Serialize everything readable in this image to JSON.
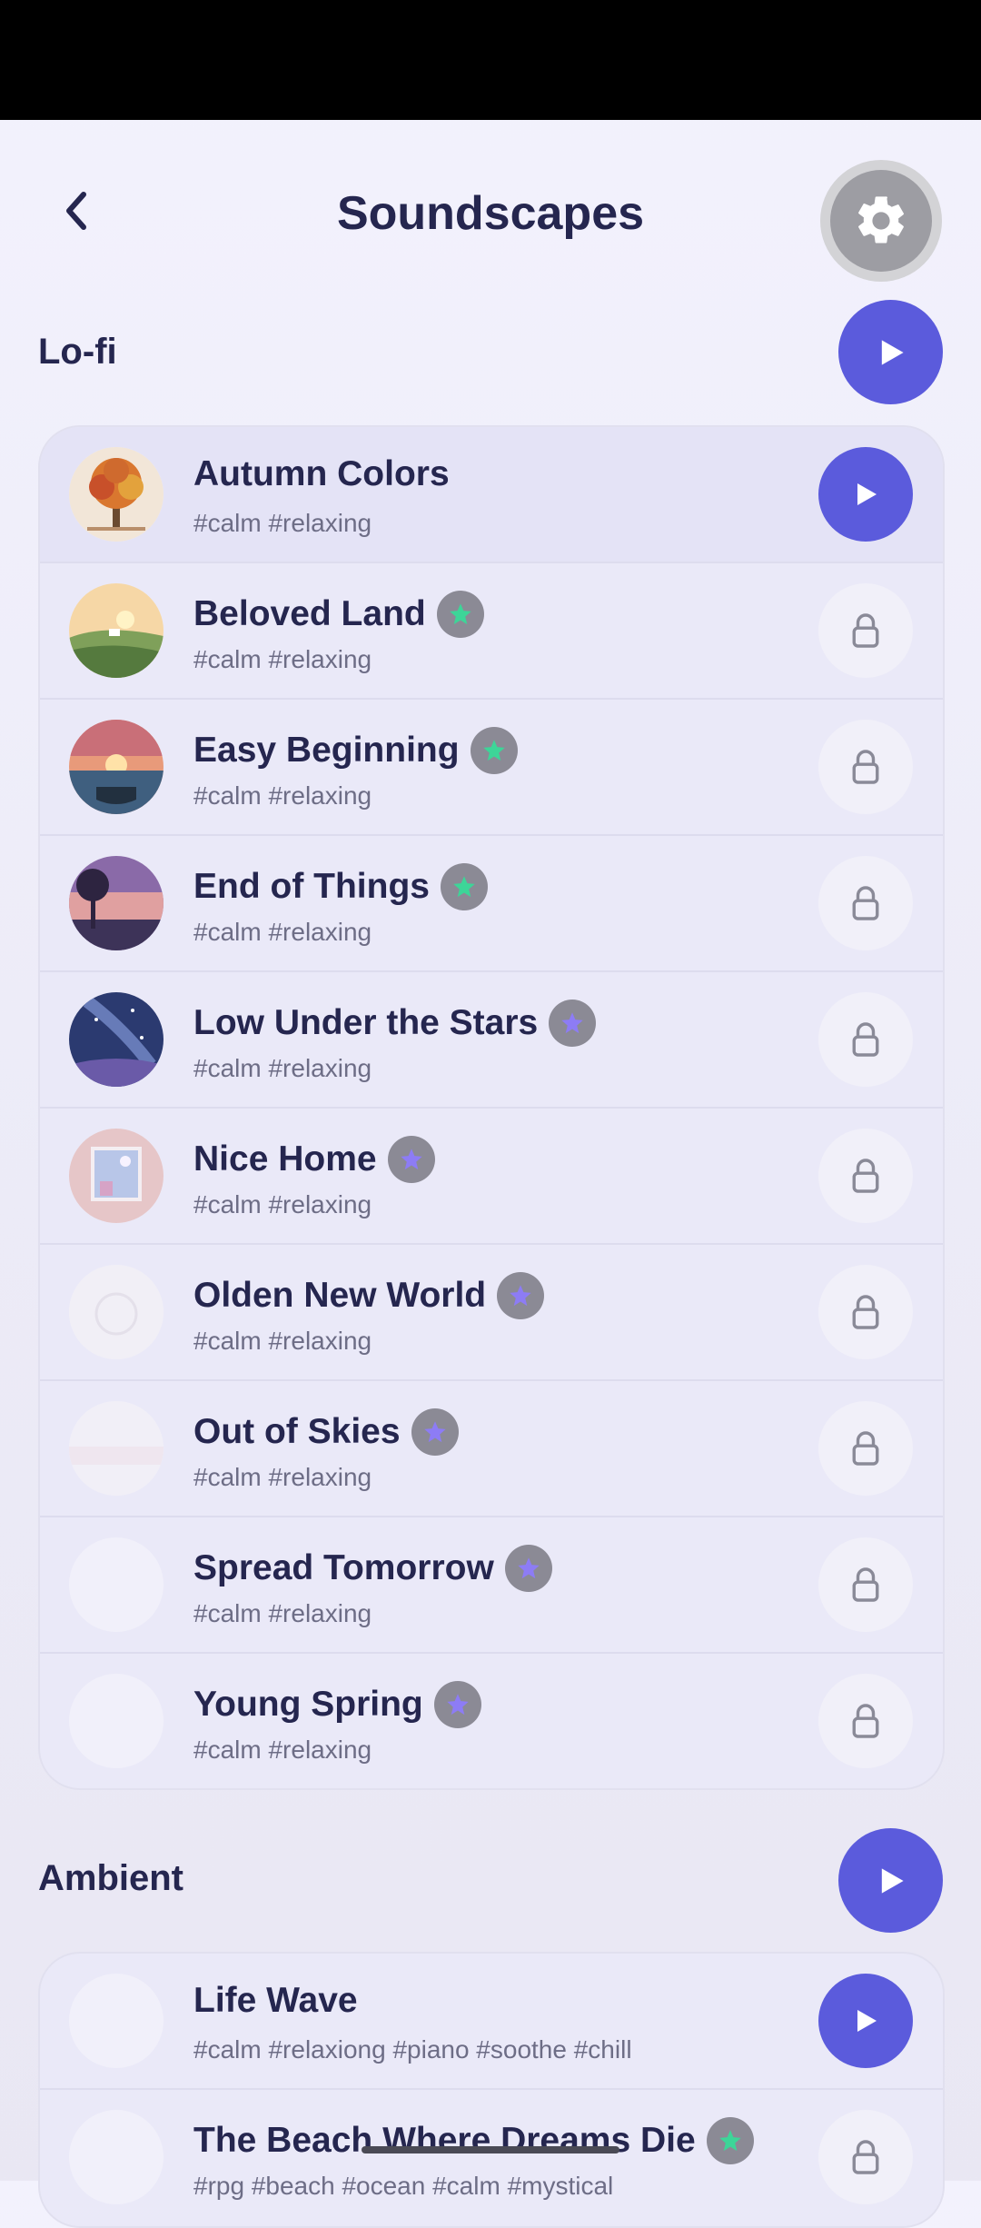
{
  "header": {
    "title": "Soundscapes",
    "back_icon": "chevron-left-icon",
    "settings_icon": "gear-icon"
  },
  "colors": {
    "accent": "#5b5bdc",
    "title_text": "#25264f",
    "tag_text": "#6d6d86",
    "badge_green": "#3dd598",
    "badge_purple": "#8d7cf5"
  },
  "sections": [
    {
      "title": "Lo-fi",
      "tracks": [
        {
          "title": "Autumn Colors",
          "tags": "#calm #relaxing",
          "premium": false,
          "action": "play"
        },
        {
          "title": "Beloved Land",
          "tags": "#calm #relaxing",
          "premium": true,
          "badge_color": "green",
          "action": "lock"
        },
        {
          "title": "Easy Beginning",
          "tags": "#calm #relaxing",
          "premium": true,
          "badge_color": "green",
          "action": "lock"
        },
        {
          "title": "End of Things",
          "tags": "#calm #relaxing",
          "premium": true,
          "badge_color": "green",
          "action": "lock"
        },
        {
          "title": "Low Under the Stars",
          "tags": "#calm #relaxing",
          "premium": true,
          "badge_color": "purple",
          "action": "lock"
        },
        {
          "title": "Nice Home",
          "tags": "#calm #relaxing",
          "premium": true,
          "badge_color": "purple",
          "action": "lock"
        },
        {
          "title": "Olden New World",
          "tags": "#calm #relaxing",
          "premium": true,
          "badge_color": "purple",
          "action": "lock"
        },
        {
          "title": "Out of Skies",
          "tags": "#calm #relaxing",
          "premium": true,
          "badge_color": "purple",
          "action": "lock"
        },
        {
          "title": "Spread Tomorrow",
          "tags": "#calm #relaxing",
          "premium": true,
          "badge_color": "purple",
          "action": "lock"
        },
        {
          "title": "Young Spring",
          "tags": "#calm #relaxing",
          "premium": true,
          "badge_color": "purple",
          "action": "lock"
        }
      ]
    },
    {
      "title": "Ambient",
      "tracks": [
        {
          "title": "Life Wave",
          "tags": "#calm #relaxiong #piano #soothe #chill",
          "premium": false,
          "action": "play"
        },
        {
          "title": "The Beach Where Dreams Die",
          "tags": "#rpg #beach #ocean #calm #mystical",
          "premium": true,
          "badge_color": "green",
          "action": "lock"
        }
      ]
    }
  ]
}
